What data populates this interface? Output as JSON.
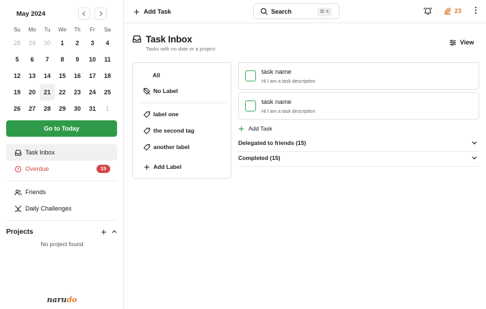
{
  "calendar": {
    "month_label": "May 2024",
    "dows": [
      "Su",
      "Mo",
      "Tu",
      "We",
      "Th",
      "Fr",
      "Sa"
    ],
    "weeks": [
      [
        {
          "d": "28",
          "m": true
        },
        {
          "d": "29",
          "m": true
        },
        {
          "d": "30",
          "m": true
        },
        {
          "d": "1"
        },
        {
          "d": "2"
        },
        {
          "d": "3"
        },
        {
          "d": "4"
        }
      ],
      [
        {
          "d": "5"
        },
        {
          "d": "6"
        },
        {
          "d": "7"
        },
        {
          "d": "8"
        },
        {
          "d": "9"
        },
        {
          "d": "10"
        },
        {
          "d": "11"
        }
      ],
      [
        {
          "d": "12"
        },
        {
          "d": "13"
        },
        {
          "d": "14"
        },
        {
          "d": "15"
        },
        {
          "d": "16"
        },
        {
          "d": "17"
        },
        {
          "d": "18"
        }
      ],
      [
        {
          "d": "19"
        },
        {
          "d": "20"
        },
        {
          "d": "21",
          "today": true
        },
        {
          "d": "22"
        },
        {
          "d": "23"
        },
        {
          "d": "24"
        },
        {
          "d": "25"
        }
      ],
      [
        {
          "d": "26"
        },
        {
          "d": "27"
        },
        {
          "d": "28"
        },
        {
          "d": "29"
        },
        {
          "d": "30"
        },
        {
          "d": "31"
        },
        {
          "d": "1",
          "m": true
        }
      ]
    ],
    "go_today_label": "Go to Today"
  },
  "sidebar": {
    "task_inbox_label": "Task Inbox",
    "overdue_label": "Overdue",
    "overdue_count": "15",
    "friends_label": "Friends",
    "daily_challenges_label": "Daily Challenges",
    "projects_title": "Projects",
    "no_project_text": "No project found",
    "brand_prefix": "naru",
    "brand_suffix": "do"
  },
  "topbar": {
    "add_task_label": "Add Task",
    "search_label": "Search",
    "search_shortcut": "⌘ K",
    "streak_count": "23"
  },
  "page": {
    "title": "Task Inbox",
    "subtitle": "Tasks with no date or a project",
    "view_label": "View"
  },
  "labels_panel": {
    "all_label": "All",
    "no_label_label": "No Label",
    "labels": [
      "label one",
      "the second tag",
      "another label"
    ],
    "add_label_label": "Add Label"
  },
  "tasks": [
    {
      "name": "task name",
      "description": "Hi I am a task description"
    },
    {
      "name": "task name",
      "description": "Hi I am a task description"
    }
  ],
  "add_task_inline_label": "Add Task",
  "sections": [
    {
      "label": "Delegated to friends (15)"
    },
    {
      "label": "Completed (15)"
    }
  ],
  "colors": {
    "accent_green": "#2f9b48",
    "overdue_red": "#d64545",
    "streak_orange": "#e27a2b"
  }
}
